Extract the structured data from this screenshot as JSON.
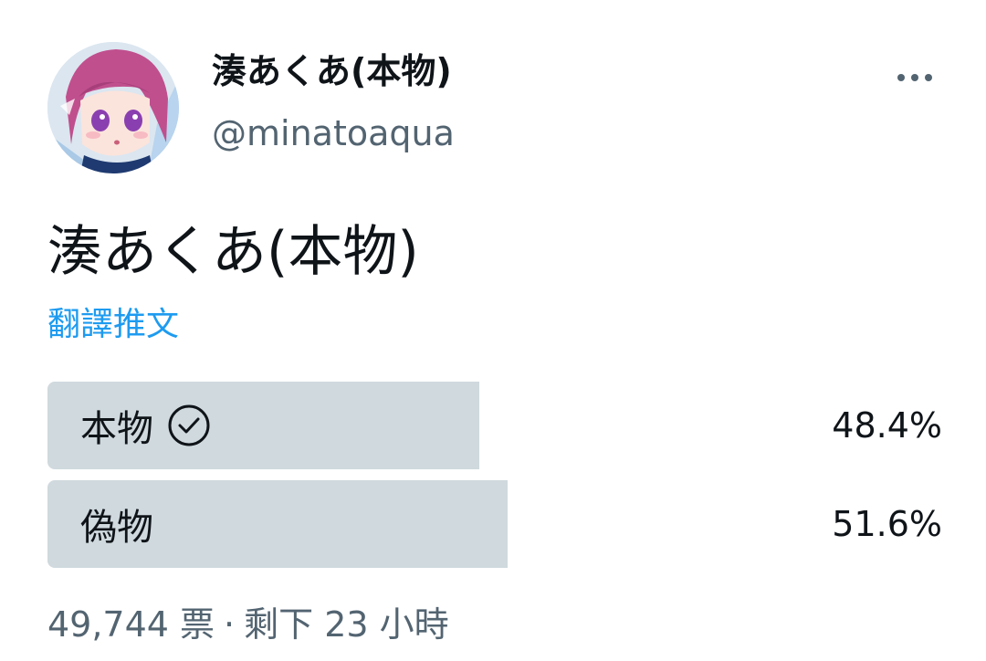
{
  "author": {
    "name": "湊あくあ(本物)",
    "handle": "@minatoaqua",
    "avatar_icon": "profile-avatar-anime-character"
  },
  "more_icon": "more-horizontal-icon",
  "tweet": {
    "text": "湊あくあ(本物)",
    "translate_label": "翻譯推文"
  },
  "poll": {
    "options": [
      {
        "label": "本物",
        "percent_text": "48.4%",
        "percent": 48.4,
        "selected": true
      },
      {
        "label": "偽物",
        "percent_text": "51.6%",
        "percent": 51.6,
        "selected": false
      }
    ],
    "votes": "49,744 票",
    "separator": "·",
    "remaining": "剩下 23 小時"
  },
  "colors": {
    "bar": "#cfd9de",
    "link": "#1d9bf0",
    "secondary_text": "#536471",
    "primary_text": "#0f1419"
  }
}
